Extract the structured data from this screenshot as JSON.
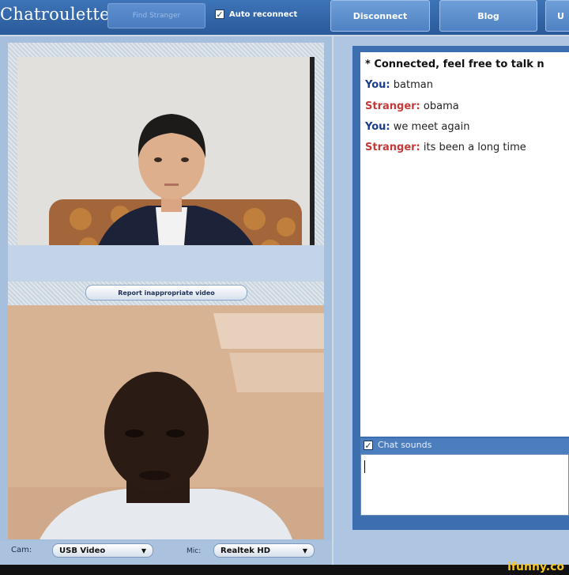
{
  "header": {
    "logo": "Chatroulette",
    "find_stranger": "Find Stranger",
    "auto_reconnect_label": "Auto reconnect",
    "auto_reconnect_checked": true,
    "disconnect": "Disconnect",
    "blog": "Blog",
    "truncated_link": "U"
  },
  "video": {
    "report_label": "Report inappropriate video"
  },
  "controls": {
    "cam_label": "Cam:",
    "cam_value": "USB Video",
    "mic_label": "Mic:",
    "mic_value": "Realtek HD"
  },
  "chat": {
    "connected": "* Connected, feel free to talk n",
    "messages": [
      {
        "who": "You:",
        "text": "batman"
      },
      {
        "who": "Stranger:",
        "text": "obama"
      },
      {
        "who": "You:",
        "text": "we meet again"
      },
      {
        "who": "Stranger:",
        "text": "its been a long time"
      }
    ],
    "sounds_label": "Chat sounds",
    "input_value": ""
  },
  "watermark": "ifunny.co",
  "icons": [
    "checkbox-icon",
    "dropdown-arrow-icon"
  ],
  "colors": {
    "header": "#2f62a6",
    "you": "#1a3c8c",
    "stranger": "#c43a3a"
  }
}
